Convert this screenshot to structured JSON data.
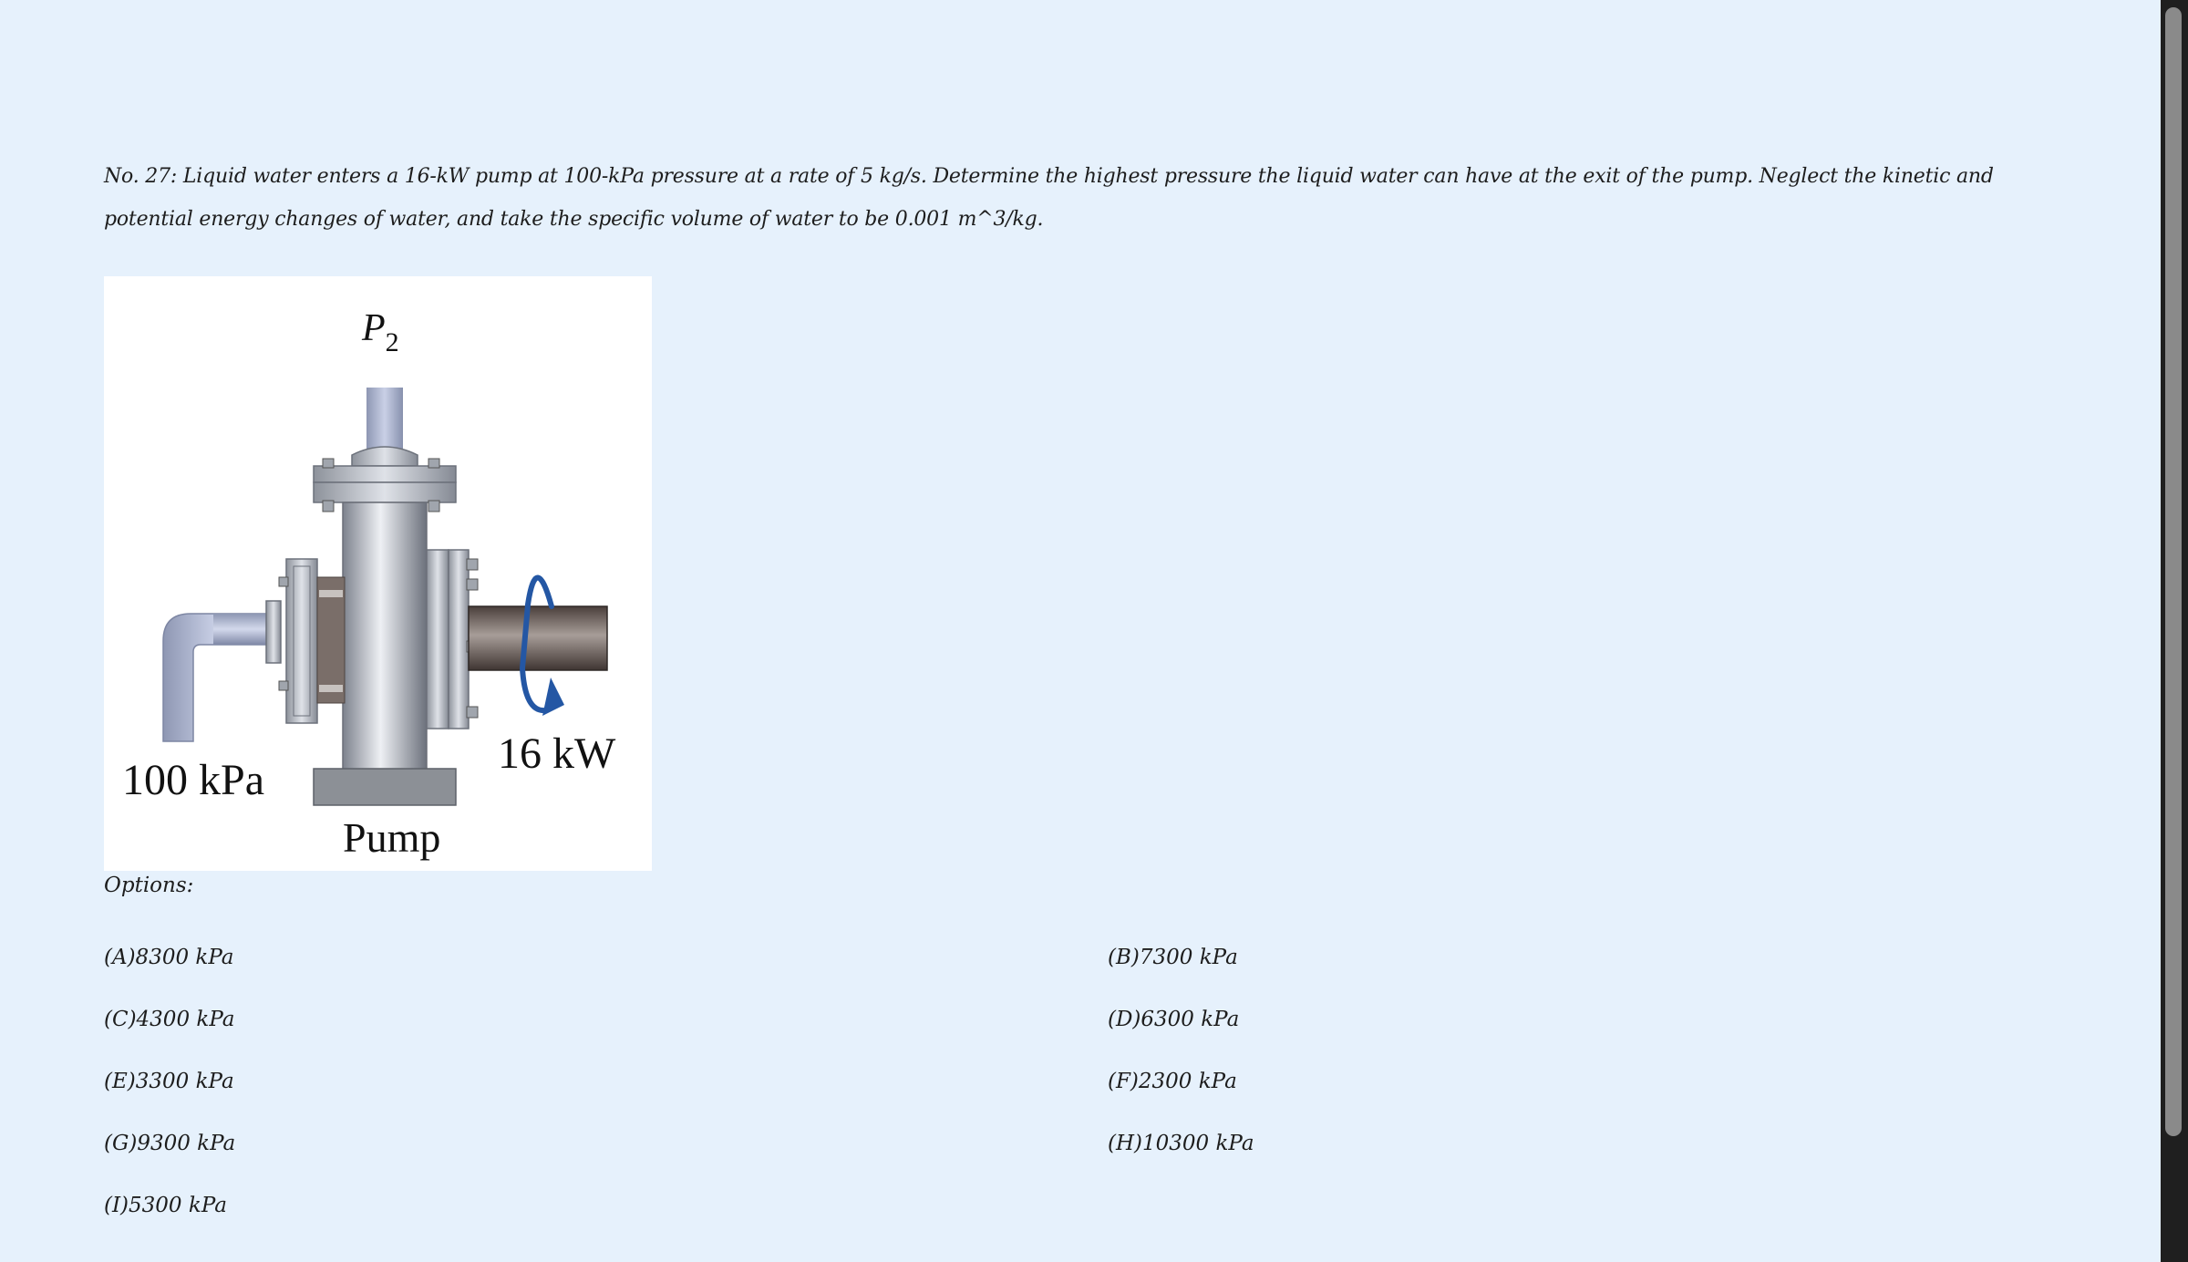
{
  "question": {
    "text": "No. 27: Liquid water enters a 16-kW pump at 100-kPa pressure at a rate of 5 kg/s. Determine the highest pressure the liquid water can have at the exit of the pump. Neglect the kinetic and potential energy changes of water, and take the specific volume of water to be 0.001 m^3/kg."
  },
  "figure": {
    "outlet_label_main": "P",
    "outlet_label_sub": "2",
    "inlet_pressure": "100 kPa",
    "power": "16 kW",
    "pump_label": "Pump"
  },
  "options_label": "Options:",
  "options": [
    "(A)8300 kPa",
    "(B)7300 kPa",
    "(C)4300 kPa",
    "(D)6300 kPa",
    "(E)3300 kPa",
    "(F)2300 kPa",
    "(G)9300 kPa",
    "(H)10300 kPa",
    "(I)5300 kPa"
  ]
}
